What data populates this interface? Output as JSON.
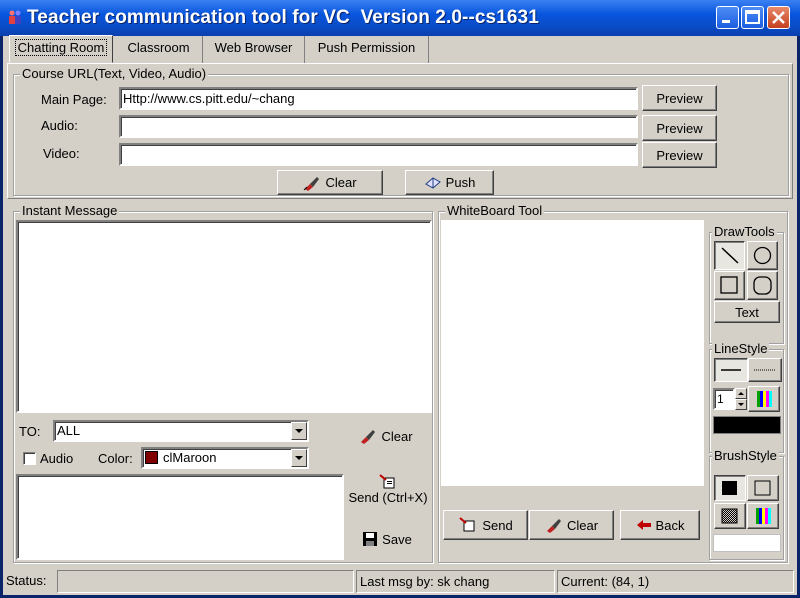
{
  "window": {
    "title": "Teacher communication tool for VC  Version 2.0--cs1631"
  },
  "tabs": [
    {
      "label": "Chatting Room",
      "active": true
    },
    {
      "label": "Classroom",
      "active": false
    },
    {
      "label": "Web Browser",
      "active": false
    },
    {
      "label": "Push Permission",
      "active": false
    }
  ],
  "course_url": {
    "group_label": "Course URL(Text, Video, Audio)",
    "main_page_label": "Main Page:",
    "main_page_value": "Http://www.cs.pitt.edu/~chang",
    "audio_label": "Audio:",
    "audio_value": "",
    "video_label": "Video:",
    "video_value": "",
    "preview_label": "Preview",
    "clear_label": "Clear",
    "push_label": "Push"
  },
  "instant_message": {
    "group_label": "Instant Message",
    "to_label": "TO:",
    "to_value": "ALL",
    "audio_label": "Audio",
    "audio_checked": false,
    "color_label": "Color:",
    "color_value": "clMaroon",
    "color_swatch": "#800000",
    "clear_label": "Clear",
    "send_label": "Send (Ctrl+X)",
    "save_label": "Save"
  },
  "whiteboard": {
    "group_label": "WhiteBoard Tool",
    "send_label": "Send",
    "clear_label": "Clear",
    "back_label": "Back",
    "drawtools_label": "DrawTools",
    "text_label": "Text",
    "linestyle_label": "LineStyle",
    "line_width": "1",
    "line_color": "#000000",
    "brushstyle_label": "BrushStyle",
    "brush_color": "#FFFFFF"
  },
  "status": {
    "status_label": "Status:",
    "status_value": "",
    "last_msg": "Last msg by: sk chang",
    "current": "Current: (84, 1)"
  }
}
